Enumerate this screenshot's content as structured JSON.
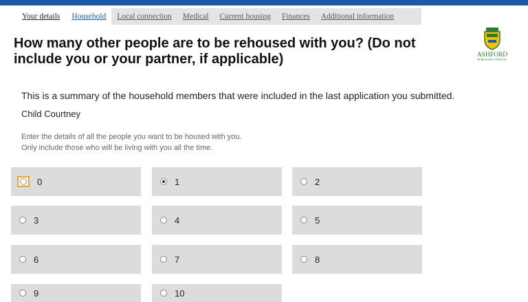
{
  "tabs": [
    {
      "label": "Your details"
    },
    {
      "label": "Household"
    },
    {
      "label": "Local connection"
    },
    {
      "label": "Medical"
    },
    {
      "label": "Current housing"
    },
    {
      "label": "Finances"
    },
    {
      "label": "Additional information"
    }
  ],
  "page": {
    "title": "How many other people are to be rehoused with you? (Do not include you or your partner, if applicable)",
    "summary": "This is a summary of the household members that were included in the last application you submitted.",
    "member": "Child Courtney",
    "hint_line1": "Enter the details of all the people you want to be housed with you.",
    "hint_line2": "Only include those who will be living with you all the time."
  },
  "logo": {
    "text_main": "ASHFORD",
    "text_sub": "BOROUGH COUNCIL"
  },
  "options": [
    "0",
    "1",
    "2",
    "3",
    "4",
    "5",
    "6",
    "7",
    "8",
    "9",
    "10"
  ],
  "selected_option": "1",
  "focused_option": "0",
  "colors": {
    "top_bar": "#1a5aa8",
    "option_bg": "#dcdcdc",
    "focus": "#f0a32b",
    "link": "#1a5aa8"
  }
}
